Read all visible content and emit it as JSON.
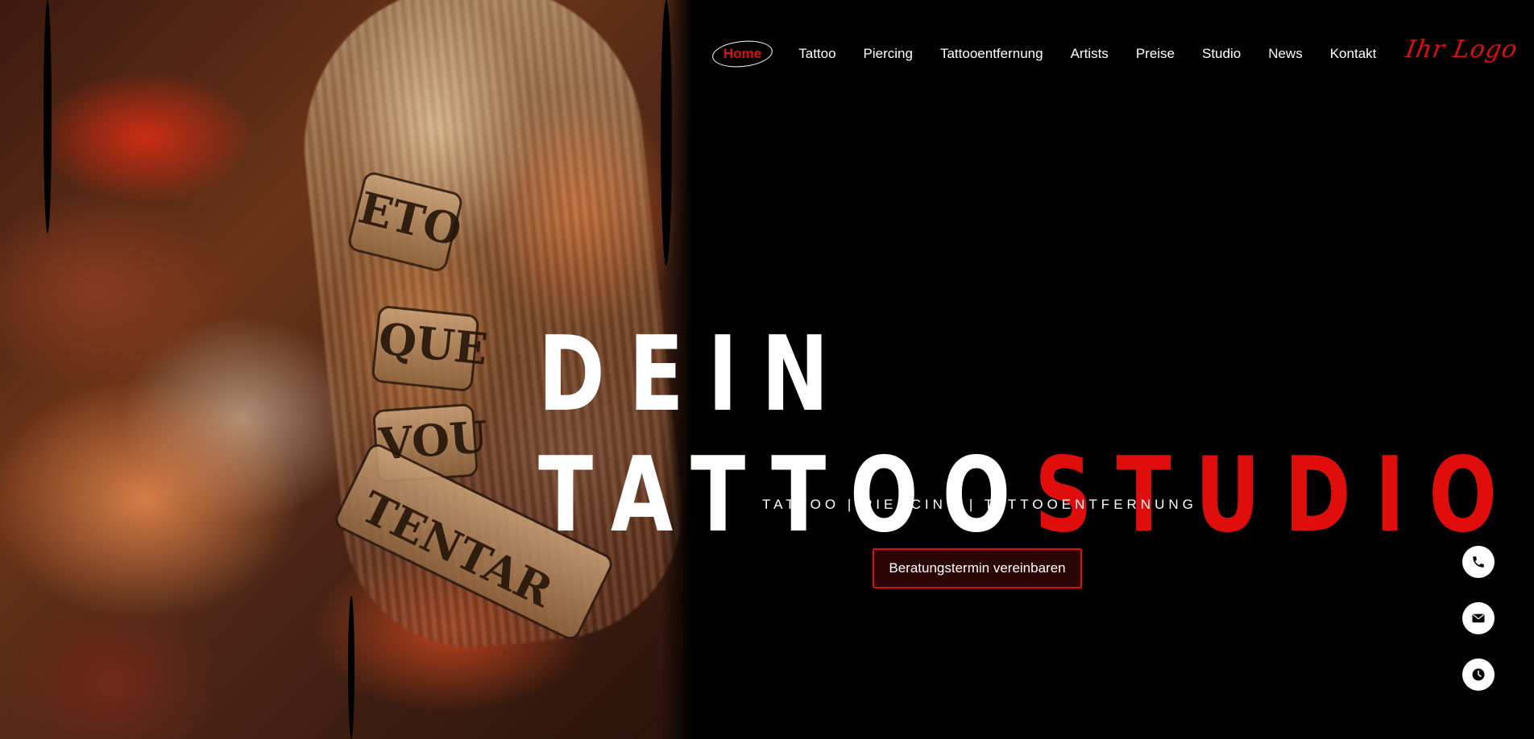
{
  "nav": {
    "items": [
      {
        "label": "Home",
        "active": true
      },
      {
        "label": "Tattoo",
        "active": false
      },
      {
        "label": "Piercing",
        "active": false
      },
      {
        "label": "Tattooentfernung",
        "active": false
      },
      {
        "label": "Artists",
        "active": false
      },
      {
        "label": "Preise",
        "active": false
      },
      {
        "label": "Studio",
        "active": false
      },
      {
        "label": "News",
        "active": false
      },
      {
        "label": "Kontakt",
        "active": false
      }
    ],
    "active_color": "#e00d0d"
  },
  "logo": {
    "text": "Ihr Logo",
    "color": "#e00d0d"
  },
  "hero": {
    "line1": "DEIN",
    "line2_white": "TATTOO",
    "line2_red": "STUDIO",
    "subline": "TATTOO  |  PIERCING  |  TATTOOENTFERNUNG",
    "cta_label": "Beratungstermin vereinbaren",
    "accent_color": "#e00d0d",
    "tattoo_scroll": [
      "ETO",
      "QUE",
      "VOU",
      "TENTAR"
    ]
  },
  "floating_buttons": [
    {
      "icon": "phone-icon"
    },
    {
      "icon": "mail-icon"
    },
    {
      "icon": "clock-icon"
    }
  ]
}
